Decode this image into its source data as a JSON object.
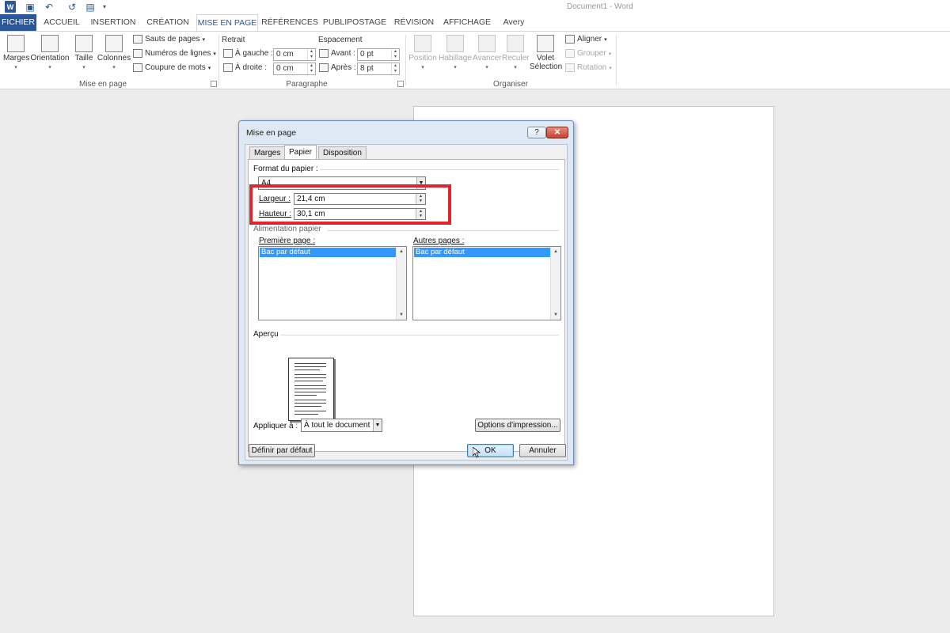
{
  "app": {
    "title": "Document1 - Word",
    "quick_access": [
      "save-icon",
      "undo-icon",
      "redo-icon",
      "save-as-icon"
    ]
  },
  "ribbon_tabs": [
    "FICHIER",
    "ACCUEIL",
    "INSERTION",
    "CRÉATION",
    "MISE EN PAGE",
    "RÉFÉRENCES",
    "PUBLIPOSTAGE",
    "RÉVISION",
    "AFFICHAGE",
    "Avery"
  ],
  "ribbon": {
    "mise_en_page": {
      "label": "Mise en page",
      "buttons": [
        "Marges",
        "Orientation",
        "Taille",
        "Colonnes"
      ],
      "small": [
        "Sauts de pages",
        "Numéros de lignes",
        "Coupure de mots"
      ]
    },
    "paragraphe": {
      "label": "Paragraphe",
      "retrait_label": "Retrait",
      "espacement_label": "Espacement",
      "gauche_label": "À gauche :",
      "gauche_value": "0 cm",
      "droite_label": "À droite :",
      "droite_value": "0 cm",
      "avant_label": "Avant :",
      "avant_value": "0  pt",
      "apres_label": "Après :",
      "apres_value": "8  pt"
    },
    "organiser": {
      "label": "Organiser",
      "buttons": [
        "Position",
        "Habillage",
        "Avancer",
        "Reculer"
      ],
      "volet_line1": "Volet",
      "volet_line2": "Sélection",
      "small": [
        "Aligner",
        "Grouper",
        "Rotation"
      ]
    }
  },
  "dialog": {
    "title": "Mise en page",
    "help": "?",
    "close": "✕",
    "tabs": [
      "Marges",
      "Papier",
      "Disposition"
    ],
    "format_label": "Format du papier :",
    "format_value": "A4",
    "largeur_label": "Largeur :",
    "largeur_value": "21,4 cm",
    "hauteur_label": "Hauteur :",
    "hauteur_value": "30,1 cm",
    "alimentation_label": "Alimentation papier",
    "premiere_label": "Première page :",
    "autres_label": "Autres pages :",
    "premiere_selected": "Bac par défaut",
    "autres_selected": "Bac par défaut",
    "apercu_label": "Aperçu",
    "appliquer_label": "Appliquer à :",
    "appliquer_value": "À tout le document",
    "options_button": "Options d'impression...",
    "default_button": "Définir par défaut",
    "ok_button": "OK",
    "cancel_button": "Annuler"
  }
}
